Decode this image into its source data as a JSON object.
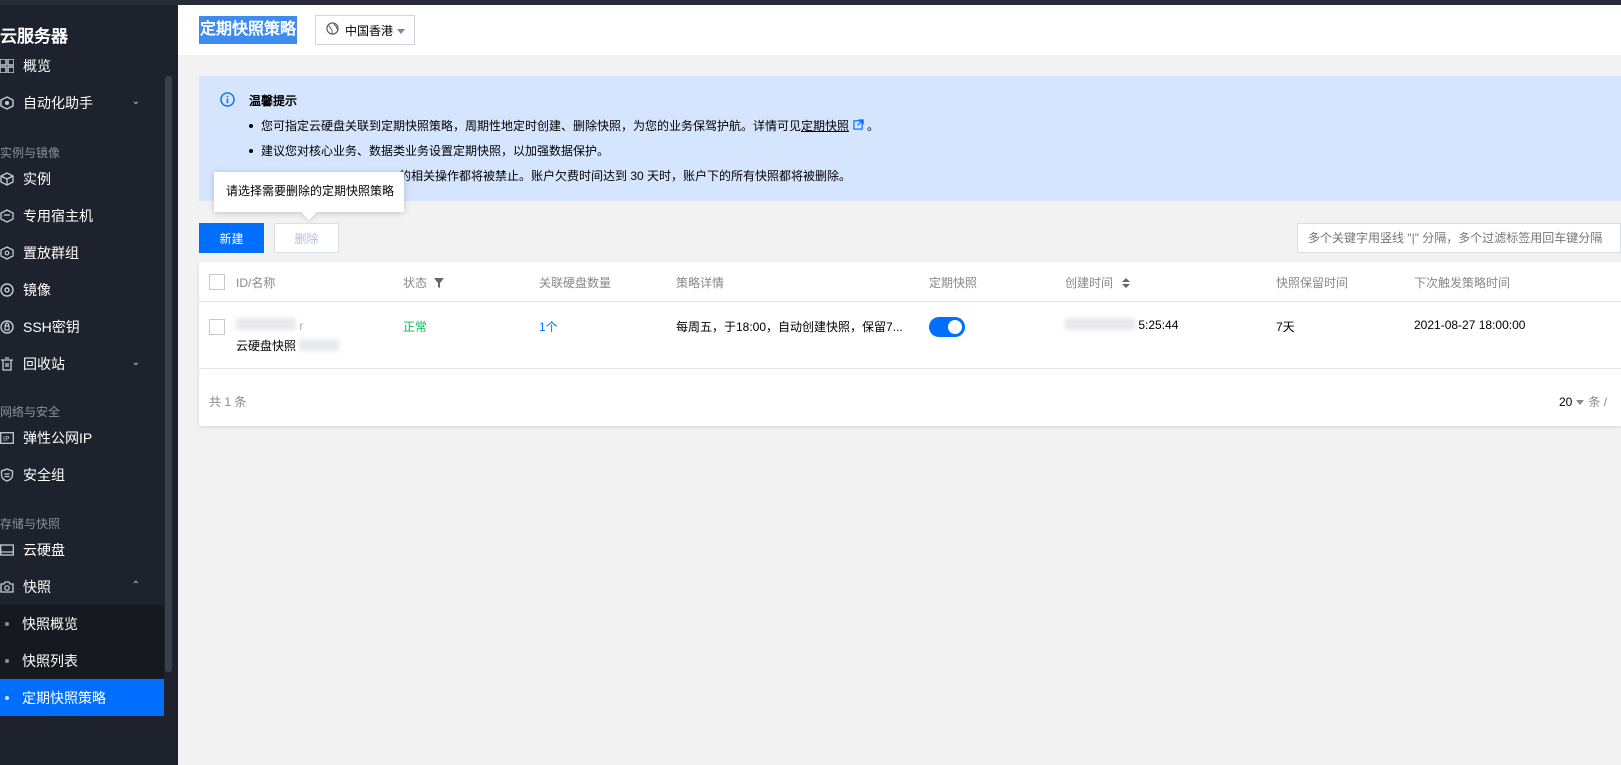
{
  "sidebar": {
    "title": "云服务器",
    "items": {
      "overview": "概览",
      "automation": "自动化助手",
      "instance": "实例",
      "dedicated_host": "专用宿主机",
      "placement_group": "置放群组",
      "image": "镜像",
      "ssh_key": "SSH密钥",
      "recycle_bin": "回收站",
      "eip": "弹性公网IP",
      "security_group": "安全组",
      "cloud_disk": "云硬盘",
      "snapshot": "快照",
      "snapshot_overview": "快照概览",
      "snapshot_list": "快照列表",
      "snapshot_policy": "定期快照策略"
    },
    "groups": {
      "instance_image": "实例与镜像",
      "network_security": "网络与安全",
      "storage_snapshot": "存储与快照"
    }
  },
  "header": {
    "title": "定期快照策略",
    "region": "中国香港"
  },
  "notice": {
    "title": "温馨提示",
    "line1_prefix": "您可指定云硬盘关联到定期快照策略，周期性地定时创建、删除快照，为您的业务保驾护航。详情可见",
    "line1_link": "定期快照",
    "line1_suffix": "。",
    "line2": "建议您对核心业务、数据类业务设置定期快照，以加强数据保护。",
    "line3_visible": "的相关操作都将被禁止。账户欠费时间达到 30 天时，账户下的所有快照都将被删除。"
  },
  "tooltip": "请选择需要删除的定期快照策略",
  "toolbar": {
    "new_label": "新建",
    "delete_label": "删除",
    "search_placeholder": "多个关键字用竖线 \"|\" 分隔，多个过滤标签用回车键分隔"
  },
  "table": {
    "headers": {
      "id_name": "ID/名称",
      "status": "状态",
      "disk_count": "关联硬盘数量",
      "policy_detail": "策略详情",
      "scheduled_snapshot": "定期快照",
      "created_time": "创建时间",
      "retention": "快照保留时间",
      "next_trigger": "下次触发策略时间"
    },
    "rows": [
      {
        "id_visible": "r",
        "name_visible": "云硬盘快照",
        "status": "正常",
        "disk_count": "1个",
        "policy_detail": "每周五，于18:00，自动创建快照，保留7...",
        "scheduled_snapshot_on": true,
        "created_time_visible": "5:25:44",
        "retention": "7天",
        "next_trigger": "2021-08-27 18:00:00"
      }
    ],
    "total": "共 1 条",
    "page_size": "20",
    "page_size_unit": "条 /"
  },
  "colors": {
    "primary": "#006eff",
    "sidebar_bg": "#1e222d",
    "notice_bg": "#d4e5fd",
    "status_ok": "#0abf5b"
  }
}
